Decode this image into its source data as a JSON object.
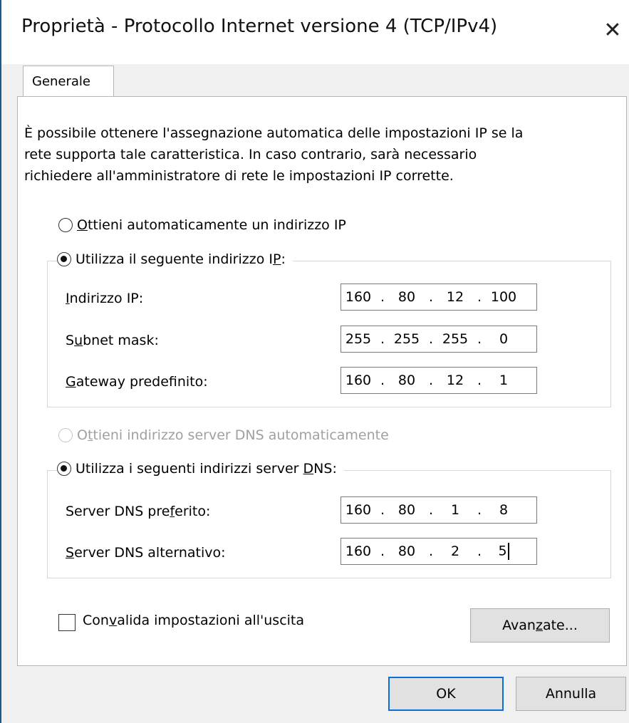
{
  "window": {
    "title": "Proprietà - Protocollo Internet versione 4 (TCP/IPv4)",
    "close_glyph": "✕"
  },
  "tabs": [
    {
      "label": "Generale"
    }
  ],
  "intro": {
    "line1": "È possibile ottenere l'assegnazione automatica delle impostazioni IP se la",
    "line2": "rete supporta tale caratteristica. In caso contrario, sarà necessario",
    "line3": "richiedere all'amministratore di rete le impostazioni IP corrette."
  },
  "ip_section": {
    "auto_option": {
      "label_pre": "",
      "label_ul": "O",
      "label_post": "ttieni automaticamente un indirizzo IP",
      "selected": false
    },
    "manual_option": {
      "label_pre": "Utilizza il seguente indirizzo I",
      "label_ul": "P",
      "label_post": ":",
      "selected": true
    },
    "fields": [
      {
        "label_pre": "",
        "label_ul": "I",
        "label_post": "ndirizzo IP:",
        "octets": [
          "160",
          "80",
          "12",
          "100"
        ]
      },
      {
        "label_pre": "S",
        "label_ul": "u",
        "label_post": "bnet mask:",
        "octets": [
          "255",
          "255",
          "255",
          "0"
        ]
      },
      {
        "label_pre": "",
        "label_ul": "G",
        "label_post": "ateway predefinito:",
        "octets": [
          "160",
          "80",
          "12",
          "1"
        ]
      }
    ]
  },
  "dns_section": {
    "auto_option": {
      "label_pre": "O",
      "label_ul": "t",
      "label_post": "tieni indirizzo server DNS automaticamente",
      "selected": false,
      "disabled": true
    },
    "manual_option": {
      "label_pre": "Utilizza i seguenti indirizzi server ",
      "label_ul": "D",
      "label_post": "NS:",
      "selected": true
    },
    "fields": [
      {
        "label_pre": "Server DNS pre",
        "label_ul": "f",
        "label_post": "erito:",
        "octets": [
          "160",
          "80",
          "1",
          "8"
        ]
      },
      {
        "label_pre": "",
        "label_ul": "S",
        "label_post": "erver DNS alternativo:",
        "octets": [
          "160",
          "80",
          "2",
          "5"
        ]
      }
    ]
  },
  "validate": {
    "label_pre": "Con",
    "label_ul": "v",
    "label_post": "alida impostazioni all'uscita",
    "checked": false
  },
  "buttons": {
    "advanced": {
      "label_pre": "Avan",
      "label_ul": "z",
      "label_post": "ate..."
    },
    "ok": "OK",
    "cancel": "Annulla"
  },
  "colors": {
    "accent": "#0a6fd6",
    "window_border": "#1b5b8a",
    "disabled_text": "#a0a0a0"
  }
}
